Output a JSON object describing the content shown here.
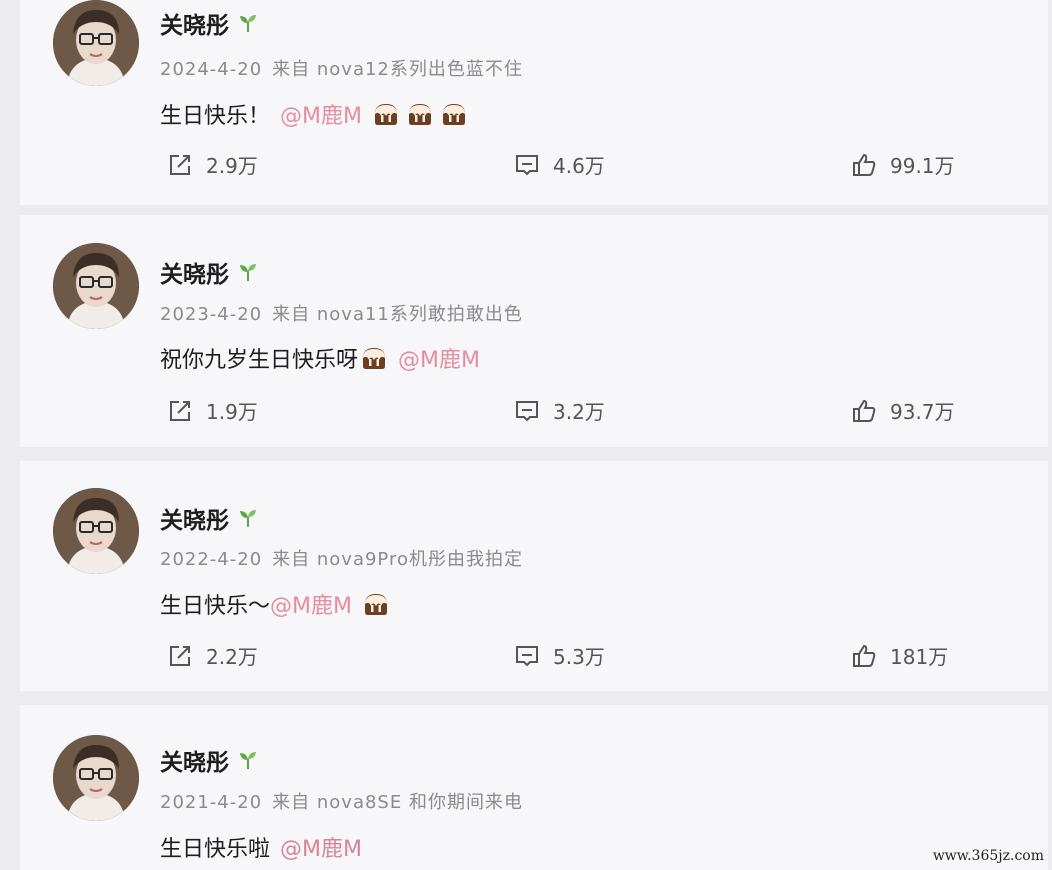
{
  "posts": [
    {
      "author": "关晓彤",
      "date": "2024-4-20",
      "source": "来自 nova12系列出色蓝不住",
      "text": "生日快乐！",
      "mention": "@M鹿M",
      "cake_count": 3,
      "reposts": "2.9万",
      "comments": "4.6万",
      "likes": "99.1万"
    },
    {
      "author": "关晓彤",
      "date": "2023-4-20",
      "source": "来自 nova11系列敢拍敢出色",
      "text": "祝你九岁生日快乐呀",
      "mention": "@M鹿M",
      "cake_count": 1,
      "reposts": "1.9万",
      "comments": "3.2万",
      "likes": "93.7万"
    },
    {
      "author": "关晓彤",
      "date": "2022-4-20",
      "source": "来自 nova9Pro机彤由我拍定",
      "text": "生日快乐～",
      "mention": "@M鹿M",
      "cake_count": 1,
      "reposts": "2.2万",
      "comments": "5.3万",
      "likes": "181万"
    },
    {
      "author": "关晓彤",
      "date": "2021-4-20",
      "source": "来自 nova8SE 和你期间来电",
      "text": "生日快乐啦",
      "mention": "@M鹿M",
      "cake_count": 0
    }
  ],
  "icons": {
    "verified": "sprout-icon",
    "cake": "birthday-cake-emoji",
    "repost": "repost-icon",
    "comment": "comment-icon",
    "like": "thumbs-up-icon"
  },
  "colors": {
    "mention": "#e58da0",
    "meta": "#8a8a8f",
    "sprout": "#5aa844"
  },
  "watermark": "www.365jz.com"
}
